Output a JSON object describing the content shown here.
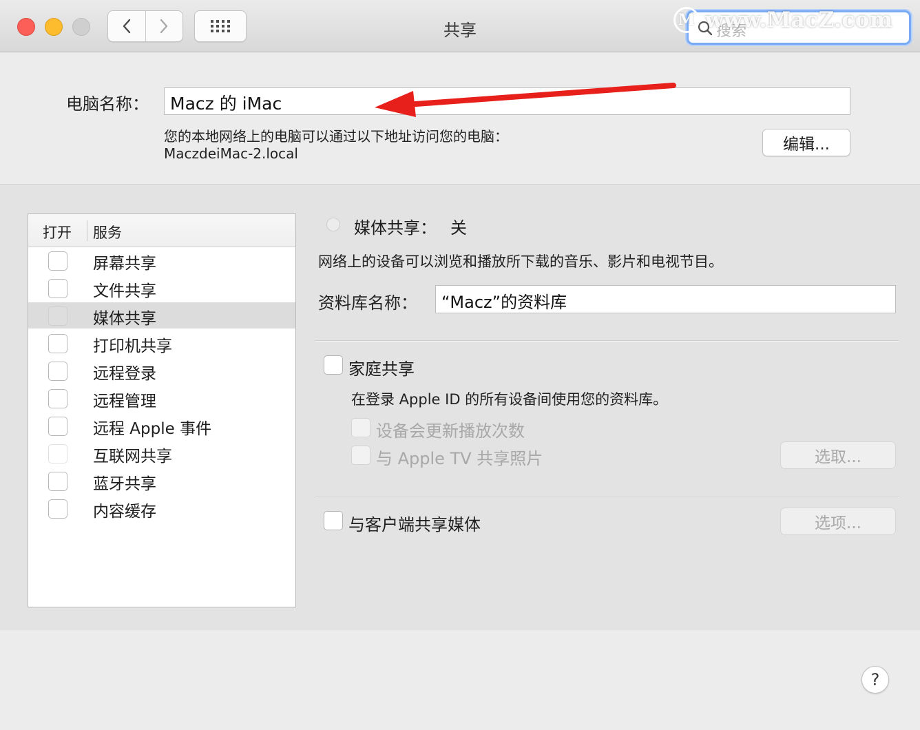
{
  "window": {
    "title": "共享",
    "search_placeholder": "搜索",
    "watermark_text": "www.MacZ.com"
  },
  "computer": {
    "name_label": "电脑名称：",
    "name_value": "Macz 的 iMac",
    "hint_line1": "您的本地网络上的电脑可以通过以下地址访问您的电脑：",
    "hint_line2": "MaczdeiMac-2.local",
    "edit_label": "编辑..."
  },
  "services": {
    "header_on": "打开",
    "header_service": "服务",
    "items": [
      {
        "label": "屏幕共享",
        "checked": false,
        "selected": false
      },
      {
        "label": "文件共享",
        "checked": false,
        "selected": false
      },
      {
        "label": "媒体共享",
        "checked": false,
        "selected": true
      },
      {
        "label": "打印机共享",
        "checked": false,
        "selected": false
      },
      {
        "label": "远程登录",
        "checked": false,
        "selected": false
      },
      {
        "label": "远程管理",
        "checked": false,
        "selected": false
      },
      {
        "label": "远程 Apple 事件",
        "checked": false,
        "selected": false
      },
      {
        "label": "互联网共享",
        "checked": false,
        "selected": false
      },
      {
        "label": "蓝牙共享",
        "checked": false,
        "selected": false
      },
      {
        "label": "内容缓存",
        "checked": false,
        "selected": false
      }
    ]
  },
  "detail": {
    "status_title": "媒体共享：",
    "status_value": "关",
    "description": "网络上的设备可以浏览和播放所下载的音乐、影片和电视节目。",
    "library_label": "资料库名称：",
    "library_value": "“Macz”的资料库",
    "home_sharing_label": "家庭共享",
    "home_sharing_desc": "在登录 Apple ID 的所有设备间使用您的资料库。",
    "update_play_count_label": "设备会更新播放次数",
    "share_photos_label": "与 Apple TV 共享照片",
    "choose_button": "选取...",
    "share_clients_label": "与客户端共享媒体",
    "options_button": "选项..."
  },
  "help_label": "?",
  "colors": {
    "close": "#fc5f57",
    "minimize": "#fdbc2e",
    "zoom_inactive": "#cfcfcf",
    "annotation_arrow": "#e8201c",
    "focus_ring": "#7aaaf3"
  }
}
